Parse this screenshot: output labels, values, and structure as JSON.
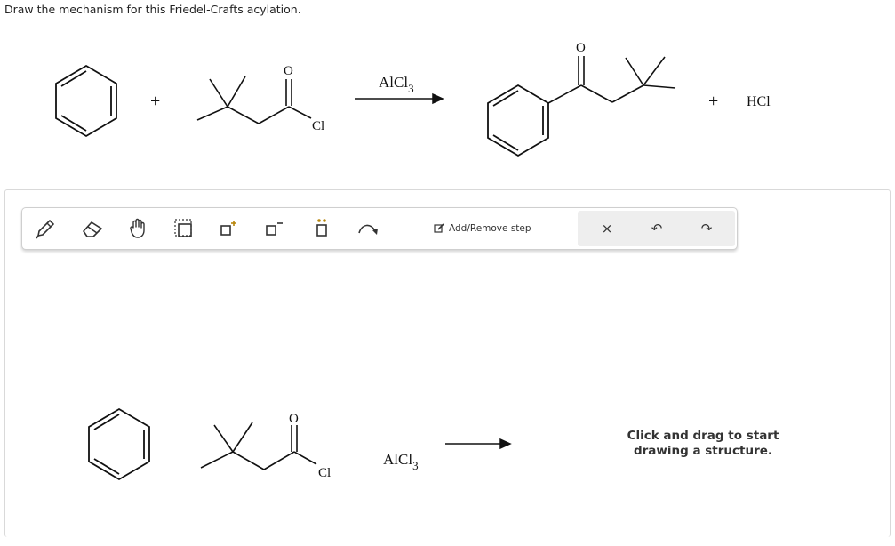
{
  "question": "Draw the mechanism for this Friedel-Crafts acylation.",
  "reaction": {
    "plus_sign": "+",
    "oxygen_label": "O",
    "chlorine_label": "Cl",
    "reagent_main": "AlCl",
    "reagent_sub": "3",
    "byproduct": "HCl"
  },
  "toolbar": {
    "tools": [
      "pencil-icon",
      "eraser-icon",
      "hand-icon",
      "select-box-icon",
      "positive-charge-icon",
      "negative-charge-icon",
      "lone-pair-icon",
      "curved-arrow-icon"
    ],
    "add_remove_step_label": "Add/Remove step",
    "clear_symbol": "×",
    "undo_symbol": "↶",
    "redo_symbol": "↷"
  },
  "canvas": {
    "hint_line1": "Click and drag to start",
    "hint_line2": "drawing a structure."
  }
}
